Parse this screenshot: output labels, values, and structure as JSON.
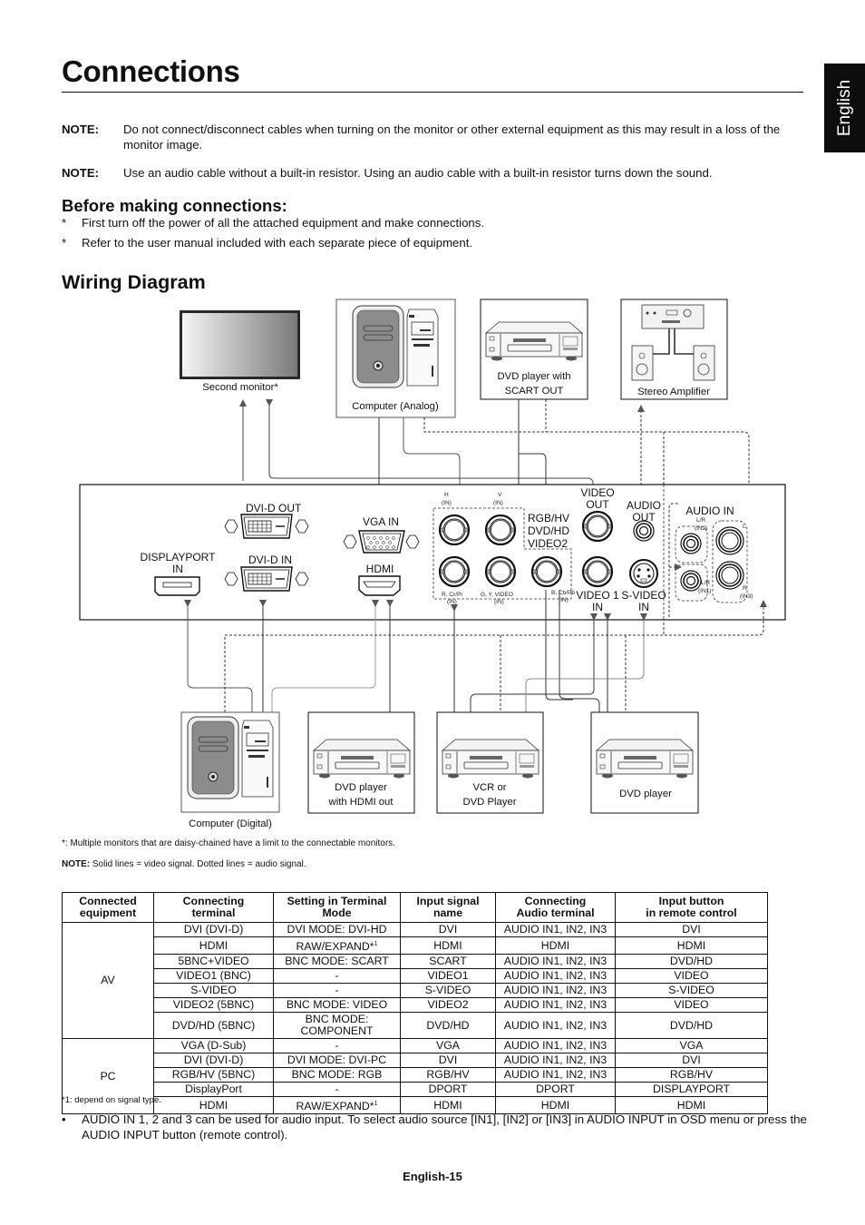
{
  "page": {
    "title": "Connections",
    "language_tab": "English",
    "page_number": "English-15"
  },
  "notes": [
    {
      "label": "NOTE:",
      "text": "Do not connect/disconnect cables when turning on the monitor or other external equipment as this may result in a loss of the monitor image."
    },
    {
      "label": "NOTE:",
      "text": "Use an audio cable without a built-in resistor. Using an audio cable with a built-in resistor turns down the sound."
    }
  ],
  "before_connections": {
    "heading": "Before making connections:",
    "items": [
      {
        "marker": "*",
        "text": "First turn off the power of all the attached equipment and make connections."
      },
      {
        "marker": "*",
        "text": "Refer to the user manual included with each separate piece of equipment."
      }
    ]
  },
  "wiring": {
    "heading": "Wiring Diagram",
    "devices": {
      "second_monitor": "Second monitor*",
      "computer_analog": "Computer (Analog)",
      "dvd_scart_1": "DVD player with",
      "dvd_scart_2": "SCART OUT",
      "stereo_amp": "Stereo Amplifier",
      "computer_digital": "Computer (Digital)",
      "dvd_hdmi_1": "DVD player",
      "dvd_hdmi_2": "with HDMI out",
      "vcr_1": "VCR or",
      "vcr_2": "DVD Player",
      "dvd_player": "DVD player"
    },
    "ports": {
      "dvi_out": "DVI-D OUT",
      "dvi_in": "DVI-D IN",
      "displayport_1": "DISPLAYPORT",
      "displayport_2": "IN",
      "vga_in": "VGA IN",
      "hdmi": "HDMI",
      "bnc_group_1": "RGB/HV",
      "bnc_group_2": "DVD/HD",
      "bnc_group_3": "VIDEO2",
      "bnc_h": "H",
      "bnc_v": "V",
      "bnc_in": "(IN)",
      "bnc_r": "R, Cr/Pr",
      "bnc_g": "G, Y, VIDEO",
      "bnc_b": "B, Cb/Pb",
      "video_out_1": "VIDEO",
      "video_out_2": "OUT",
      "audio_out_1": "AUDIO",
      "audio_out_2": "OUT",
      "video1_in_1": "VIDEO 1",
      "video1_in_2": "IN",
      "svideo_in_1": "S-VIDEO",
      "svideo_in_2": "IN",
      "audio_in": "AUDIO IN",
      "lr": "L/R",
      "in2": "(IN2)",
      "in1": "(IN1)",
      "in3": "(IN3)",
      "l": "L",
      "r": "R"
    },
    "footnote_star": "*: Multiple monitors that are daisy-chained have a limit to the connectable monitors.",
    "note_label": "NOTE:",
    "note_text": "Solid lines = video signal. Dotted lines = audio signal."
  },
  "table": {
    "headers": [
      [
        "Connected",
        "equipment"
      ],
      [
        "Connecting",
        "terminal"
      ],
      [
        "Setting in Terminal Mode"
      ],
      [
        "Input signal name"
      ],
      [
        "Connecting",
        "Audio terminal"
      ],
      [
        "Input button",
        "in remote control"
      ]
    ],
    "groups": [
      {
        "name": "AV",
        "rows": [
          [
            "DVI (DVI-D)",
            "DVI MODE: DVI-HD",
            "DVI",
            "AUDIO IN1, IN2, IN3",
            "DVI"
          ],
          [
            "HDMI",
            "RAW/EXPAND*1",
            "HDMI",
            "HDMI",
            "HDMI"
          ],
          [
            "5BNC+VIDEO",
            "BNC MODE: SCART",
            "SCART",
            "AUDIO IN1, IN2, IN3",
            "DVD/HD"
          ],
          [
            "VIDEO1 (BNC)",
            "-",
            "VIDEO1",
            "AUDIO IN1, IN2, IN3",
            "VIDEO"
          ],
          [
            "S-VIDEO",
            "-",
            "S-VIDEO",
            "AUDIO IN1, IN2, IN3",
            "S-VIDEO"
          ],
          [
            "VIDEO2 (5BNC)",
            "BNC MODE: VIDEO",
            "VIDEO2",
            "AUDIO IN1, IN2, IN3",
            "VIDEO"
          ],
          [
            "DVD/HD (5BNC)",
            "BNC MODE: COMPONENT",
            "DVD/HD",
            "AUDIO IN1, IN2, IN3",
            "DVD/HD"
          ]
        ]
      },
      {
        "name": "PC",
        "rows": [
          [
            "VGA (D-Sub)",
            "-",
            "VGA",
            "AUDIO IN1, IN2, IN3",
            "VGA"
          ],
          [
            "DVI (DVI-D)",
            "DVI MODE: DVI-PC",
            "DVI",
            "AUDIO IN1, IN2, IN3",
            "DVI"
          ],
          [
            "RGB/HV (5BNC)",
            "BNC MODE: RGB",
            "RGB/HV",
            "AUDIO IN1, IN2, IN3",
            "RGB/HV"
          ],
          [
            "DisplayPort",
            "-",
            "DPORT",
            "DPORT",
            "DISPLAYPORT"
          ],
          [
            "HDMI",
            "RAW/EXPAND*1",
            "HDMI",
            "HDMI",
            "HDMI"
          ]
        ]
      }
    ],
    "footnote": "*1: depend on signal type."
  },
  "audio_note": {
    "marker": "•",
    "text": "AUDIO IN 1, 2 and 3 can be used for audio input. To select audio source [IN1], [IN2] or [IN3] in AUDIO INPUT in OSD menu or press the AUDIO INPUT button (remote control)."
  }
}
